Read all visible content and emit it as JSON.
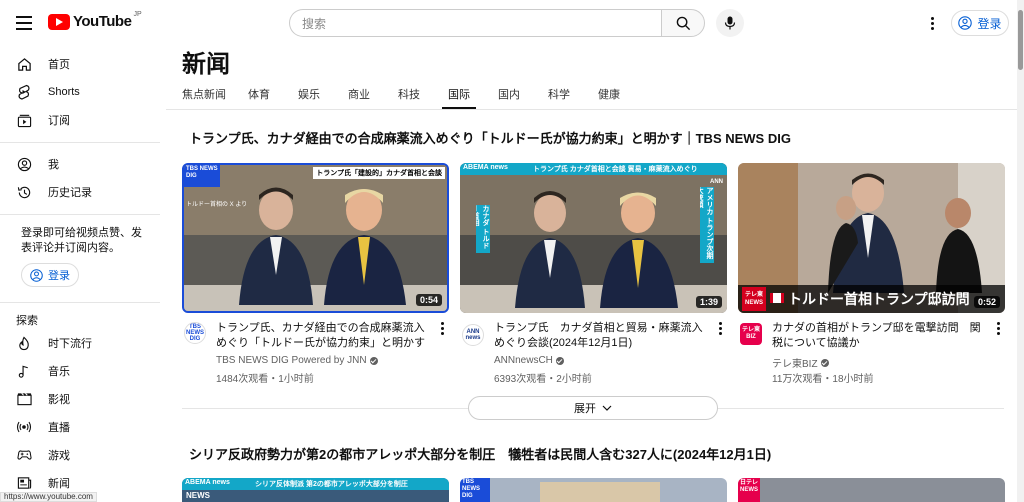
{
  "header": {
    "logo_text": "YouTube",
    "region": "JP",
    "search_placeholder": "搜索",
    "signin_label": "登录"
  },
  "sidebar": {
    "items": [
      {
        "label": "首页",
        "icon": "home-icon"
      },
      {
        "label": "Shorts",
        "icon": "shorts-icon"
      },
      {
        "label": "订阅",
        "icon": "subscriptions-icon"
      },
      {
        "label": "我",
        "icon": "you-icon"
      },
      {
        "label": "历史记录",
        "icon": "history-icon"
      }
    ],
    "signin_note": "登录即可给视频点赞、发表评论并订阅内容。",
    "signin_label": "登录",
    "explore_heading": "探索",
    "explore_items": [
      {
        "label": "时下流行",
        "icon": "trending-icon"
      },
      {
        "label": "音乐",
        "icon": "music-icon"
      },
      {
        "label": "影视",
        "icon": "movies-icon"
      },
      {
        "label": "直播",
        "icon": "live-icon"
      },
      {
        "label": "游戏",
        "icon": "gaming-icon"
      },
      {
        "label": "新闻",
        "icon": "news-icon"
      }
    ]
  },
  "status_url": "https://www.youtube.com",
  "page": {
    "title": "新闻",
    "tabs": [
      "焦点新闻",
      "体育",
      "娱乐",
      "商业",
      "科技",
      "国际",
      "国内",
      "科学",
      "健康"
    ],
    "active_tab": "国际"
  },
  "sections": [
    {
      "title": "トランプ氏、カナダ経由での合成麻薬流入めぐり「トルドー氏が協力約束」と明かす｜TBS NEWS DIG",
      "videos": [
        {
          "title": "トランプ氏、カナダ経由での合成麻薬流入めぐり「トルドー氏が協力約束」と明かす｜TBS NEWS DIG",
          "channel": "TBS NEWS DIG Powered by JNN",
          "meta": "1484次观看・1小时前",
          "duration": "0:54",
          "avatar_text": "TBS NEWS DIG",
          "thumb_caption": "トランプ氏「建設的」カナダ首相と会談",
          "thumb_brand": "TBS NEWS DIG",
          "thumb_sub": "トルドー首相の X より"
        },
        {
          "title": "トランプ氏　カナダ首相と貿易・麻薬流入めぐり会談(2024年12月1日)",
          "channel": "ANNnewsCH",
          "meta": "6393次观看・2小时前",
          "duration": "1:39",
          "avatar_text": "ANN news",
          "thumb_caption": "トランプ氏 カナダ首相と会談 貿易・麻薬流入めぐり",
          "thumb_brand": "ABEMA news",
          "thumb_left": "カナダ トルドー首相",
          "thumb_right": "アメリカ トランプ次期大統領",
          "thumb_corner": "ANN"
        },
        {
          "title": "カナダの首相がトランプ邸を電撃訪問　関税について協議か",
          "channel": "テレ東BIZ",
          "meta": "11万次观看・18小时前",
          "duration": "0:52",
          "avatar_text": "テレ東 BIZ",
          "thumb_caption": "トルドー首相トランプ邸訪問",
          "thumb_brand": "テレ東 NEWS"
        }
      ],
      "expand_label": "展开"
    },
    {
      "title": "シリア反政府勢力が第2の都市アレッポ大部分を制圧　犠牲者は民間人含む327人に(2024年12月1日)",
      "thumbs": [
        {
          "brand": "ABEMA news",
          "caption": "シリア反体制派 第2の都市アレッポ大部分を制圧",
          "sub": "NEWS"
        },
        {
          "brand": "TBS NEWS DIG"
        },
        {
          "brand": "日テレ NEWS"
        }
      ]
    }
  ]
}
